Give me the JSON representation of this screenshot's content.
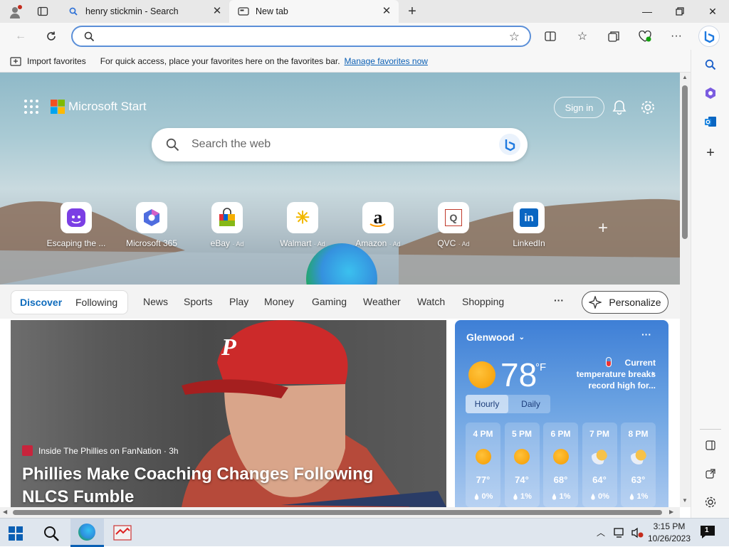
{
  "tabs": [
    {
      "title": "henry stickmin - Search",
      "icon": "search-icon"
    },
    {
      "title": "New tab",
      "icon": "newtab-icon"
    }
  ],
  "address": {
    "value": ""
  },
  "favbar": {
    "import_label": "Import favorites",
    "hint": "For quick access, place your favorites here on the favorites bar.",
    "manage_link": "Manage favorites now"
  },
  "brand": {
    "title": "Microsoft Start"
  },
  "header": {
    "signin": "Sign in"
  },
  "search": {
    "placeholder": "Search the web"
  },
  "quicklinks": [
    {
      "label": "Escaping the ...",
      "ad": "",
      "glyph": "",
      "color": "#7b3fe4"
    },
    {
      "label": "Microsoft 365",
      "ad": "",
      "glyph": "",
      "color": "#2b6fd6"
    },
    {
      "label": "eBay",
      "ad": "· Ad",
      "glyph": "",
      "color": "#e53238"
    },
    {
      "label": "Walmart",
      "ad": "· Ad",
      "glyph": "✳",
      "color": "#0071ce"
    },
    {
      "label": "Amazon",
      "ad": "· Ad",
      "glyph": "a",
      "color": "#111111"
    },
    {
      "label": "QVC",
      "ad": "· Ad",
      "glyph": "Q",
      "color": "#c0392b"
    },
    {
      "label": "LinkedIn",
      "ad": "",
      "glyph": "in",
      "color": "#0a66c2"
    }
  ],
  "nav": {
    "discover": "Discover",
    "following": "Following",
    "items": [
      "News",
      "Sports",
      "Play",
      "Money",
      "Gaming",
      "Weather",
      "Watch",
      "Shopping"
    ],
    "more": "···",
    "personalize": "Personalize"
  },
  "news": {
    "source": "Inside The Phillies on FanNation · 3h",
    "headline": "Phillies Make Coaching Changes Following NLCS Fumble",
    "cap_letter": "P"
  },
  "weather": {
    "location": "Glenwood",
    "temp": "78",
    "unit": "°F",
    "alert": "Current temperature breaks record high for...",
    "tab_hourly": "Hourly",
    "tab_daily": "Daily",
    "hours": [
      {
        "time": "4 PM",
        "temp": "77°",
        "precip": "0%",
        "icon": "sun-icon"
      },
      {
        "time": "5 PM",
        "temp": "74°",
        "precip": "1%",
        "icon": "sun-icon"
      },
      {
        "time": "6 PM",
        "temp": "68°",
        "precip": "1%",
        "icon": "sun-icon"
      },
      {
        "time": "7 PM",
        "temp": "64°",
        "precip": "0%",
        "icon": "moon-cloud-icon"
      },
      {
        "time": "8 PM",
        "temp": "63°",
        "precip": "1%",
        "icon": "moon-cloud-icon"
      }
    ]
  },
  "clock": {
    "time": "3:15 PM",
    "date": "10/26/2023"
  },
  "notifications": {
    "count": "1"
  },
  "colors": {
    "accent": "#0f6cbd",
    "link": "#0a5fb4"
  }
}
